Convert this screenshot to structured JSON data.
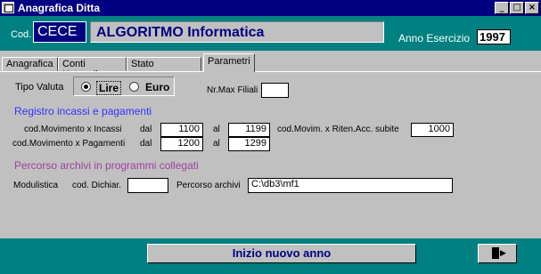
{
  "window": {
    "title": "Anagrafica Ditta"
  },
  "title_buttons": {
    "minimize": "_",
    "maximize": "□",
    "close": "×"
  },
  "header": {
    "cod_label": "Cod.",
    "cod_value": "CECE",
    "company_name": "ALGORITMO Informatica",
    "anno_label": "Anno Esercizio",
    "anno_value": "1997"
  },
  "tabs": [
    {
      "label": "Anagrafica",
      "active": false
    },
    {
      "label": "Conti Notevoli",
      "active": false
    },
    {
      "label": "Stato avanzam.",
      "active": false
    },
    {
      "label": "Parametri",
      "active": true
    }
  ],
  "parametri": {
    "tipo_valuta_label": "Tipo Valuta",
    "valuta_options": [
      {
        "label": "Lire",
        "selected": true
      },
      {
        "label": "Euro",
        "selected": false
      }
    ],
    "nr_max_filiali_label": "Nr.Max Filiali",
    "nr_max_filiali_value": "",
    "registro_title": "Registro incassi e pagamenti",
    "incassi_label": "cod.Movimento x Incassi",
    "incassi_dal_label": "dal",
    "incassi_dal": "1100",
    "incassi_al_label": "al",
    "incassi_al": "1199",
    "pagamenti_label": "cod.Movimento x Pagamenti",
    "pagamenti_dal_label": "dal",
    "pagamenti_dal": "1200",
    "pagamenti_al_label": "al",
    "pagamenti_al": "1299",
    "riten_label": "cod.Movim. x Riten.Acc. subite",
    "riten_value": "1000",
    "percorso_title": "Percorso archivi in programmi collegati",
    "modulistica_label": "Modulistica",
    "cod_dichiar_label": "cod. Dichiar.",
    "cod_dichiar_value": "",
    "percorso_label": "Percorso archivi",
    "percorso_value": "C:\\db3\\mf1"
  },
  "footer": {
    "new_year_button": "Inizio nuovo anno"
  },
  "colors": {
    "header": "#008080",
    "title": "#000080",
    "section_blue": "#3333ff",
    "section_purple": "#a040a0"
  }
}
